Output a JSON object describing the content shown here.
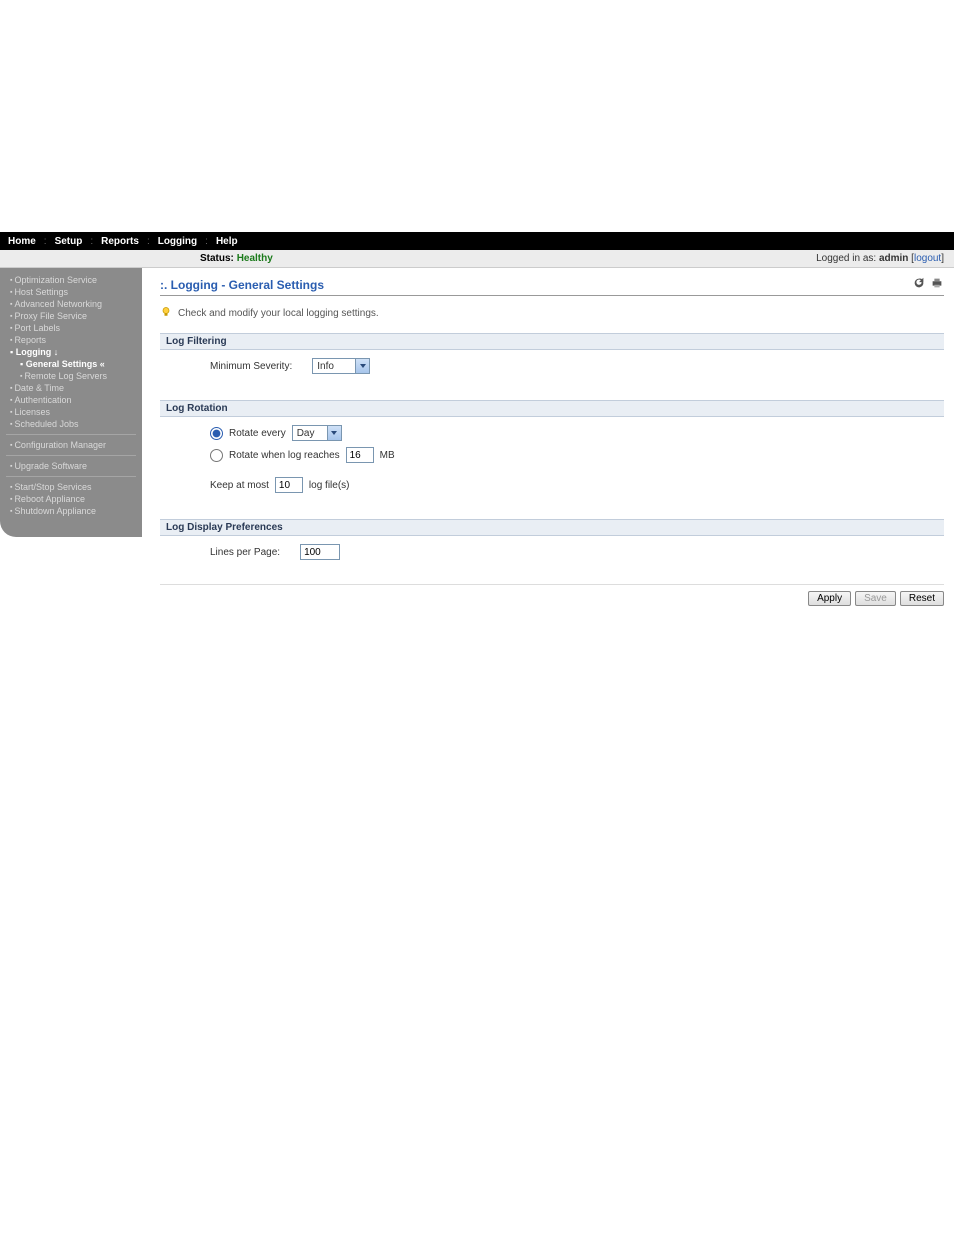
{
  "topnav": {
    "items": [
      "Home",
      "Setup",
      "Reports",
      "Logging",
      "Help"
    ]
  },
  "status": {
    "label": "Status:",
    "value": "Healthy"
  },
  "login": {
    "prefix": "Logged in as:",
    "user": "admin",
    "logout": "logout"
  },
  "sidebar": {
    "items": [
      "Optimization Service",
      "Host Settings",
      "Advanced Networking",
      "Proxy File Service",
      "Port Labels",
      "Reports"
    ],
    "logging": {
      "label": "Logging",
      "arrow": "↓",
      "general": "General Settings",
      "general_marker": "«",
      "remote": "Remote Log Servers"
    },
    "items2": [
      "Date & Time",
      "Authentication",
      "Licenses",
      "Scheduled Jobs"
    ],
    "config_mgr": "Configuration Manager",
    "upgrade": "Upgrade Software",
    "items3": [
      "Start/Stop Services",
      "Reboot Appliance",
      "Shutdown Appliance"
    ]
  },
  "page_title": ":. Logging - General Settings",
  "tip": "Check and modify your local logging settings.",
  "filtering": {
    "heading": "Log Filtering",
    "min_sev_label": "Minimum Severity:",
    "min_sev_value": "Info"
  },
  "rotation": {
    "heading": "Log Rotation",
    "rotate_every_label": "Rotate every",
    "rotate_every_value": "Day",
    "rotate_when_label": "Rotate when log reaches",
    "rotate_when_value": "16",
    "rotate_when_unit": "MB",
    "keep_label_pre": "Keep at most",
    "keep_value": "10",
    "keep_label_post": "log file(s)"
  },
  "display_prefs": {
    "heading": "Log Display Preferences",
    "lines_label": "Lines per Page:",
    "lines_value": "100"
  },
  "buttons": {
    "apply": "Apply",
    "save": "Save",
    "reset": "Reset"
  }
}
